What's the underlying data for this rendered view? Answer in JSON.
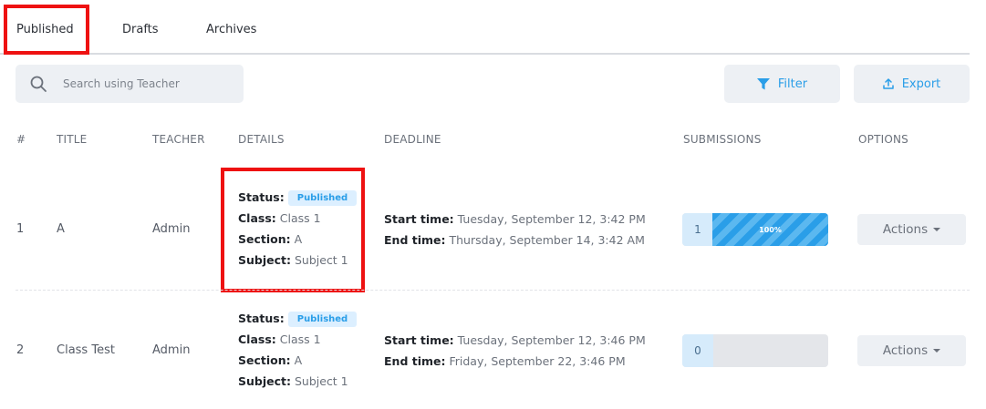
{
  "tabs": [
    {
      "label": "Published",
      "active": true
    },
    {
      "label": "Drafts",
      "active": false
    },
    {
      "label": "Archives",
      "active": false
    }
  ],
  "search": {
    "placeholder": "Search using Teacher",
    "value": ""
  },
  "toolbar": {
    "filter_label": "Filter",
    "export_label": "Export"
  },
  "table": {
    "headers": [
      "#",
      "TITLE",
      "TEACHER",
      "DETAILS",
      "DEADLINE",
      "SUBMISSIONS",
      "OPTIONS"
    ],
    "rows": [
      {
        "index": "1",
        "title": "A",
        "teacher": "Admin",
        "status_label": "Status:",
        "status": "Published",
        "class_label": "Class:",
        "class": "Class 1",
        "section_label": "Section:",
        "section": "A",
        "subject_label": "Subject:",
        "subject": "Subject 1",
        "start_label": "Start time:",
        "start": "Tuesday, September 12, 3:42 PM",
        "end_label": "End time:",
        "end": "Thursday, September 14, 3:42 AM",
        "submissions": "1",
        "progress_label": "100%",
        "progress": 1.0,
        "actions_label": "Actions"
      },
      {
        "index": "2",
        "title": "Class Test",
        "teacher": "Admin",
        "status_label": "Status:",
        "status": "Published",
        "class_label": "Class:",
        "class": "Class 1",
        "section_label": "Section:",
        "section": "A",
        "subject_label": "Subject:",
        "subject": "Subject 1",
        "start_label": "Start time:",
        "start": "Tuesday, September 12, 3:46 PM",
        "end_label": "End time:",
        "end": "Friday, September 22, 3:46 PM",
        "submissions": "0",
        "progress_label": "",
        "progress": 0.0,
        "actions_label": "Actions"
      }
    ]
  },
  "colors": {
    "accent": "#2a9ee8",
    "highlight": "#ee1111",
    "badge_bg": "#dcefff"
  },
  "icons": {
    "search": "search-icon",
    "filter": "filter-icon",
    "export": "upload-icon",
    "caret": "caret-down-icon"
  }
}
